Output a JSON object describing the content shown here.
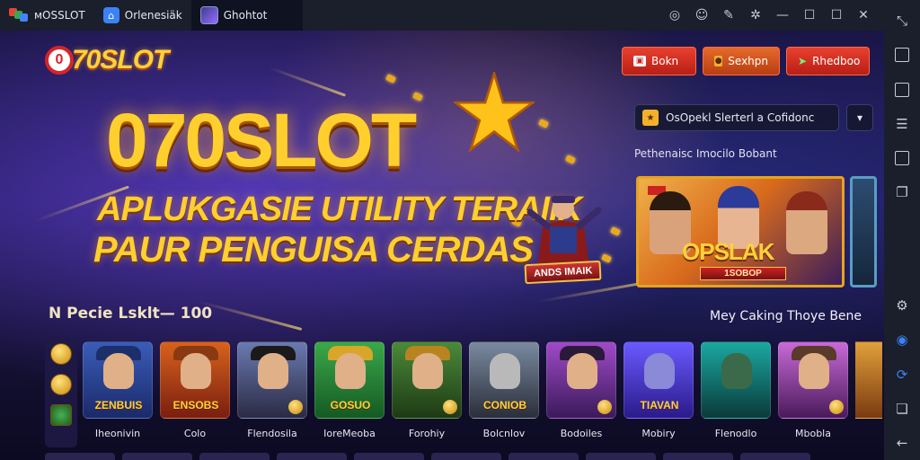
{
  "window": {
    "tabs": [
      {
        "label": "ᴍOSSLOT",
        "active": false
      },
      {
        "label": "Orlenesiäk",
        "active": false
      },
      {
        "label": "Ghohtot",
        "active": true
      }
    ]
  },
  "sidebar": {
    "icons": [
      "expand-icon",
      "package-icon",
      "screenshot-icon",
      "record-icon",
      "folder-icon",
      "copy-icon",
      "settings-icon",
      "location-icon",
      "rotate-icon",
      "layers-icon",
      "back-icon"
    ]
  },
  "app": {
    "logo_text": "70SLOT",
    "logo_prefix": "0",
    "hero": {
      "title": "070SLOT",
      "line1": "APLUKGASIE UTILITY TERAIIK",
      "line2": "PAUR PENGUISA CERDAS",
      "mascot_label": "ANDS IMAIK"
    },
    "header_buttons": [
      {
        "label": "Bokn",
        "icon": "login-icon"
      },
      {
        "label": "Sexhpn",
        "icon": "coin-icon"
      },
      {
        "label": "Rhedboo",
        "icon": "arrow-icon"
      }
    ],
    "promo_bar": {
      "text": "OsOpekl Slerterl a Cofidonc"
    },
    "section_label": "Pethenaisc Imocilo Bobant",
    "banner": {
      "title": "OPSLAK",
      "subtitle": "1SOBOP"
    },
    "games_title": "N Pecie Lsklt— 100",
    "games_right": "Mey Caking Thoye Bene",
    "games": [
      {
        "name": "Iheonivin",
        "caption": "ZENBUIS"
      },
      {
        "name": "Colo",
        "caption": "ENSOBS"
      },
      {
        "name": "Flendosila",
        "caption": ""
      },
      {
        "name": "IoreMeoba",
        "caption": "GOSUO"
      },
      {
        "name": "Forohiy",
        "caption": ""
      },
      {
        "name": "Bolcnlov",
        "caption": "CONIOB"
      },
      {
        "name": "Bodoiles",
        "caption": ""
      },
      {
        "name": "Mobiry",
        "caption": "TIAVAN"
      },
      {
        "name": "Flenodlo",
        "caption": ""
      },
      {
        "name": "Mbobla",
        "caption": ""
      }
    ]
  },
  "colors": {
    "accent_red": "#e8402e",
    "gold": "#ffcf2e",
    "chrome": "#1b1e2b"
  }
}
